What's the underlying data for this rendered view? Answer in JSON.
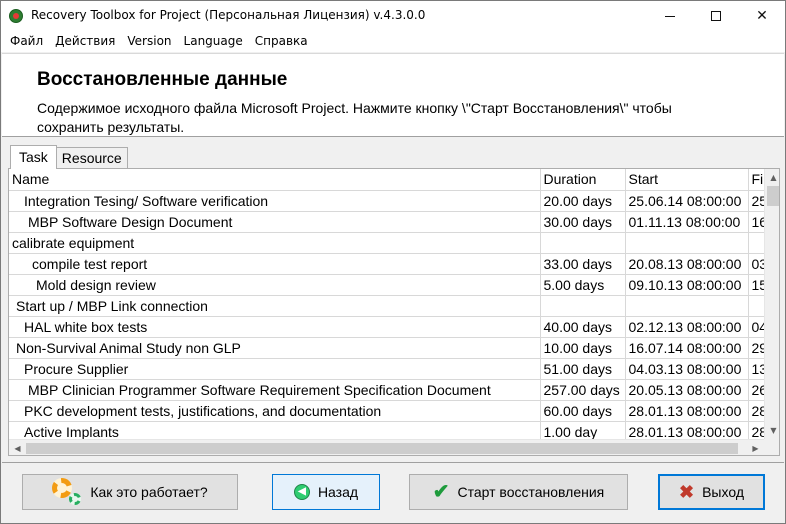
{
  "window": {
    "title": "Recovery Toolbox for Project (Персональная Лицензия) v.4.3.0.0",
    "controls": {
      "minimize": "minimize",
      "maximize": "maximize",
      "close": "✕"
    }
  },
  "menu": [
    "Файл",
    "Действия",
    "Version",
    "Language",
    "Справка"
  ],
  "header": {
    "title": "Восстановленные данные",
    "description": "Содержимое исходного файла Microsoft Project. Нажмите кнопку \\\"Старт Восстановления\\\" чтобы сохранить результаты."
  },
  "tabs": [
    {
      "label": "Task",
      "active": true
    },
    {
      "label": "Resource",
      "active": false
    }
  ],
  "grid": {
    "columns": [
      "Name",
      "Duration",
      "Start",
      "Fi"
    ],
    "rows": [
      {
        "name": "Integration Tesing/ Software verification",
        "indent": 3,
        "duration": "20.00 days",
        "start": "25.06.14 08:00:00",
        "finish": "25"
      },
      {
        "name": "MBP Software Design Document",
        "indent": 4,
        "duration": "30.00 days",
        "start": "01.11.13 08:00:00",
        "finish": "16"
      },
      {
        "name": "calibrate equipment",
        "indent": 0,
        "duration": "",
        "start": "",
        "finish": ""
      },
      {
        "name": "compile test report",
        "indent": 5,
        "duration": "33.00 days",
        "start": "20.08.13 08:00:00",
        "finish": "03"
      },
      {
        "name": "Mold design review",
        "indent": 6,
        "duration": "5.00 days",
        "start": "09.10.13 08:00:00",
        "finish": "15"
      },
      {
        "name": "Start up / MBP Link connection",
        "indent": 1,
        "duration": "",
        "start": "",
        "finish": ""
      },
      {
        "name": "HAL white box tests",
        "indent": 3,
        "duration": "40.00 days",
        "start": "02.12.13 08:00:00",
        "finish": "04"
      },
      {
        "name": "Non-Survival Animal Study non GLP",
        "indent": 1,
        "duration": "10.00 days",
        "start": "16.07.14 08:00:00",
        "finish": "29"
      },
      {
        "name": "Procure Supplier",
        "indent": 3,
        "duration": "51.00 days",
        "start": "04.03.13 08:00:00",
        "finish": "13"
      },
      {
        "name": "MBP Clinician Programmer Software Requirement Specification Document",
        "indent": 4,
        "duration": "257.00 days",
        "start": "20.05.13 08:00:00",
        "finish": "26"
      },
      {
        "name": "PKC development tests, justifications, and documentation",
        "indent": 3,
        "duration": "60.00 days",
        "start": "28.01.13 08:00:00",
        "finish": "28"
      },
      {
        "name": "Active Implants",
        "indent": 3,
        "duration": "1.00 day",
        "start": "28.01.13 08:00:00",
        "finish": "28"
      }
    ]
  },
  "scrollbars": {
    "up": "▲",
    "down": "▼",
    "left": "◀",
    "right": "▶"
  },
  "footer": {
    "how_label": "Как это работает?",
    "back_label": "Назад",
    "start_label": "Старт восстановления",
    "exit_label": "Выход"
  },
  "icons": {
    "app": "app-icon",
    "how": "gears-icon",
    "back": "back-arrow-icon",
    "start": "checkmark-icon",
    "exit": "x-icon"
  },
  "colors": {
    "accent": "#0078d7",
    "check": "#1e9b3c",
    "exit_x": "#c0392b"
  }
}
